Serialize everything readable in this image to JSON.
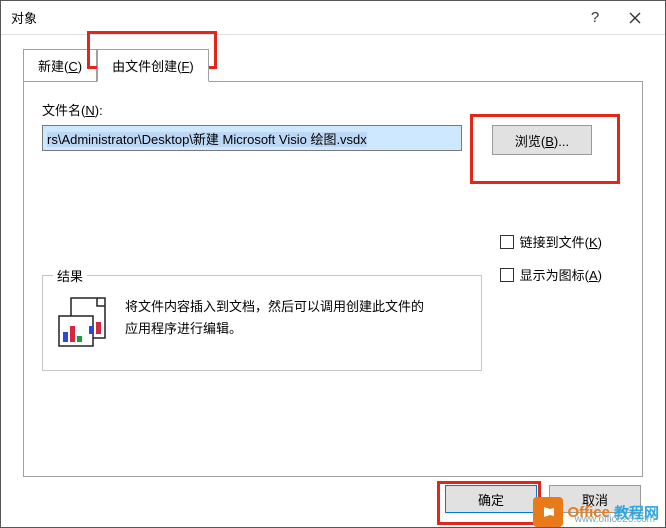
{
  "window": {
    "title": "对象"
  },
  "tabs": {
    "create_new": "新建(C)",
    "create_from_file": "由文件创建(F)"
  },
  "form": {
    "file_label": "文件名(N):",
    "file_value": "rs\\Administrator\\Desktop\\新建 Microsoft Visio 绘图.vsdx",
    "browse_label": "浏览(B)...",
    "link_to_file": "链接到文件(K)",
    "display_as_icon": "显示为图标(A)"
  },
  "result": {
    "legend": "结果",
    "text": "将文件内容插入到文档，然后可以调用创建此文件的应用程序进行编辑。"
  },
  "footer": {
    "ok": "确定",
    "cancel": "取消"
  },
  "watermark": {
    "brand_a": "Office",
    "brand_b": "教程网",
    "url": "www.office26.com"
  }
}
